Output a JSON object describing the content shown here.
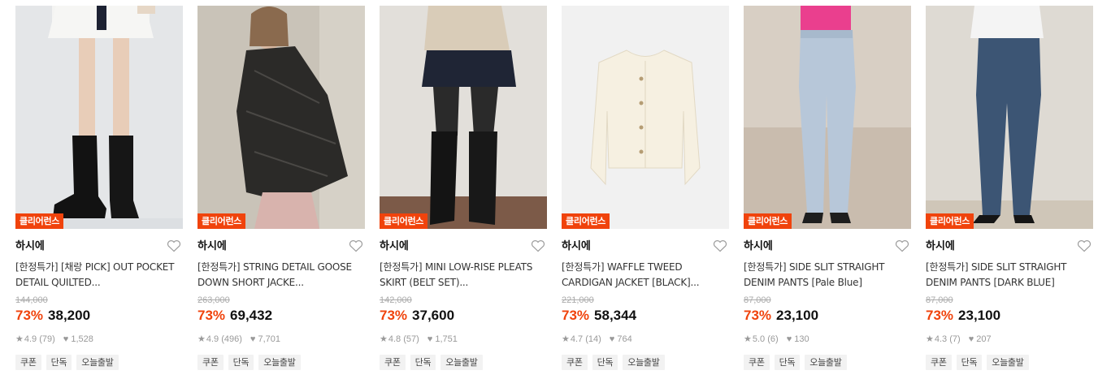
{
  "colors": {
    "accent": "#f0430c",
    "muted": "#999999",
    "tag_bg": "#f2f2f2"
  },
  "icons": {
    "wishlist": "heart-outline-icon",
    "rating": "star-icon",
    "likes": "heart-icon"
  },
  "products": [
    {
      "badge": "클리어런스",
      "brand": "하시에",
      "title": "[한정특가] [채랑 PICK] OUT POCKET DETAIL QUILTED...",
      "original_price": "144,000",
      "discount": "73%",
      "price": "38,200",
      "rating": "4.9",
      "reviews": "(79)",
      "likes": "1,528",
      "tags": [
        "쿠폰",
        "단독",
        "오늘출발"
      ]
    },
    {
      "badge": "클리어런스",
      "brand": "하시에",
      "title": "[한정특가] STRING DETAIL GOOSE DOWN SHORT JACKE...",
      "original_price": "263,000",
      "discount": "73%",
      "price": "69,432",
      "rating": "4.9",
      "reviews": "(496)",
      "likes": "7,701",
      "tags": [
        "쿠폰",
        "단독",
        "오늘출발"
      ]
    },
    {
      "badge": "클리어런스",
      "brand": "하시에",
      "title": "[한정특가] MINI LOW-RISE PLEATS SKIRT (BELT SET)...",
      "original_price": "142,000",
      "discount": "73%",
      "price": "37,600",
      "rating": "4.8",
      "reviews": "(57)",
      "likes": "1,751",
      "tags": [
        "쿠폰",
        "단독",
        "오늘출발"
      ]
    },
    {
      "badge": "클리어런스",
      "brand": "하시에",
      "title": "[한정특가] WAFFLE TWEED CARDIGAN JACKET [BLACK]...",
      "original_price": "221,000",
      "discount": "73%",
      "price": "58,344",
      "rating": "4.7",
      "reviews": "(14)",
      "likes": "764",
      "tags": [
        "쿠폰",
        "단독",
        "오늘출발"
      ]
    },
    {
      "badge": "클리어런스",
      "brand": "하시에",
      "title": "[한정특가] SIDE SLIT STRAIGHT DENIM PANTS [Pale Blue]",
      "original_price": "87,000",
      "discount": "73%",
      "price": "23,100",
      "rating": "5.0",
      "reviews": "(6)",
      "likes": "130",
      "tags": [
        "쿠폰",
        "단독",
        "오늘출발"
      ]
    },
    {
      "badge": "클리어런스",
      "brand": "하시에",
      "title": "[한정특가] SIDE SLIT STRAIGHT DENIM PANTS [DARK BLUE]",
      "original_price": "87,000",
      "discount": "73%",
      "price": "23,100",
      "rating": "4.3",
      "reviews": "(7)",
      "likes": "207",
      "tags": [
        "쿠폰",
        "단독",
        "오늘출발"
      ]
    }
  ]
}
